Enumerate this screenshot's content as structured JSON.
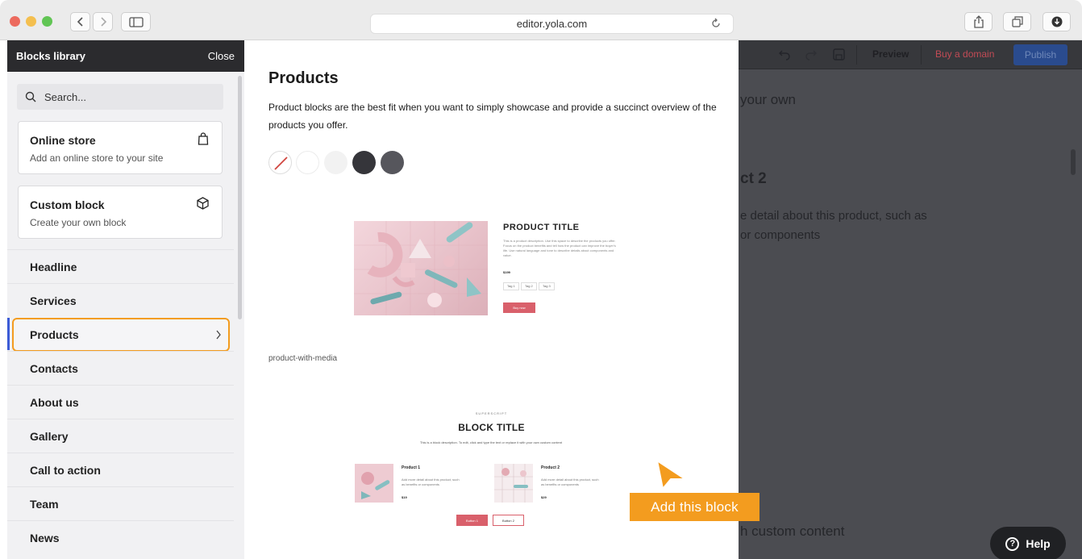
{
  "browser": {
    "url": "editor.yola.com",
    "traffic_lights": [
      "#ec6a5e",
      "#f4bf4f",
      "#61c554"
    ]
  },
  "sidebar": {
    "title": "Blocks library",
    "close_label": "Close",
    "search_placeholder": "Search...",
    "cards": [
      {
        "title": "Online store",
        "subtitle": "Add an online store to your site",
        "icon": "shopping-bag-icon"
      },
      {
        "title": "Custom block",
        "subtitle": "Create your own block",
        "icon": "cube-icon"
      }
    ],
    "categories": [
      "Headline",
      "Services",
      "Products",
      "Contacts",
      "About us",
      "Gallery",
      "Call to action",
      "Team",
      "News"
    ],
    "active_category": "Products",
    "accent": "#f39c1f"
  },
  "panel": {
    "title": "Products",
    "description": "Product blocks are the best fit when you want to simply showcase and provide a succinct overview of the products you offer.",
    "swatches": [
      "none",
      "#ffffff",
      "#f2f2f2",
      "#35353a",
      "#56565c"
    ],
    "product_with_media": {
      "title": "PRODUCT TITLE",
      "description": "This is a product description. Use this space to describe the products you offer. Focus on the product benefits and tell how the product can improve the buyer's life. Use natural language and tone to describe details about components and value.",
      "price": "$199",
      "tags": [
        "Tag 1",
        "Tag 2",
        "Tag 3"
      ],
      "button": "Buy now",
      "caption": "product-with-media"
    },
    "block_list": {
      "superscript": "SUPERSCRIPT",
      "title": "BLOCK TITLE",
      "description": "This is a block description. To edit, click and type the text or replace it with your own custom content",
      "products": [
        {
          "name": "Product 1",
          "text": "Add more detail about this product, such as benefits or components",
          "price": "$19"
        },
        {
          "name": "Product 2",
          "text": "Add more detail about this product, such as benefits or components",
          "price": "$29"
        }
      ],
      "buttons": [
        "Button 1",
        "Button 2"
      ]
    }
  },
  "tooltip": {
    "label": "Add this block"
  },
  "editor": {
    "preview": "Preview",
    "buy_domain": "Buy a domain",
    "publish": "Publish",
    "texts": [
      "your own",
      "ct 2",
      "e detail about this product, such as",
      "or components",
      "h custom content"
    ]
  },
  "help": {
    "label": "Help"
  }
}
